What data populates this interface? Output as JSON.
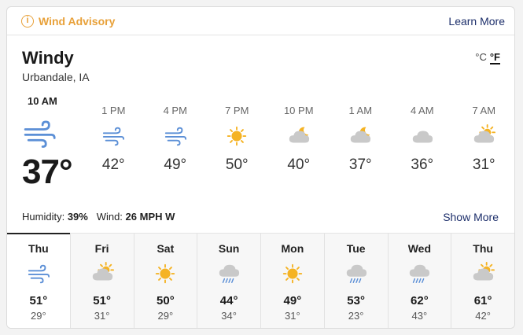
{
  "advisory": {
    "icon": "info-icon",
    "title": "Wind Advisory",
    "link": "Learn More"
  },
  "current": {
    "condition": "Windy",
    "location": "Urbandale, IA",
    "time": "10 AM",
    "icon": "wind-icon",
    "temp": "37°",
    "humidity_label": "Humidity:",
    "humidity": "39%",
    "wind_label": "Wind:",
    "wind": "26 MPH W"
  },
  "units": {
    "c": "°C",
    "f": "°F",
    "selected": "F"
  },
  "hourly": [
    {
      "time": "1 PM",
      "icon": "wind-icon",
      "temp": "42°"
    },
    {
      "time": "4 PM",
      "icon": "wind-icon",
      "temp": "49°"
    },
    {
      "time": "7 PM",
      "icon": "sun-icon",
      "temp": "50°"
    },
    {
      "time": "10 PM",
      "icon": "moon-cloud-icon",
      "temp": "40°"
    },
    {
      "time": "1 AM",
      "icon": "moon-cloud-icon",
      "temp": "37°"
    },
    {
      "time": "4 AM",
      "icon": "cloud-icon",
      "temp": "36°"
    },
    {
      "time": "7 AM",
      "icon": "sun-cloud-icon",
      "temp": "31°"
    }
  ],
  "show_more": "Show More",
  "daily": [
    {
      "day": "Thu",
      "icon": "wind-icon",
      "hi": "51°",
      "lo": "29°"
    },
    {
      "day": "Fri",
      "icon": "sun-cloud-icon",
      "hi": "51°",
      "lo": "31°"
    },
    {
      "day": "Sat",
      "icon": "sun-icon",
      "hi": "50°",
      "lo": "29°"
    },
    {
      "day": "Sun",
      "icon": "rain-cloud-icon",
      "hi": "44°",
      "lo": "34°"
    },
    {
      "day": "Mon",
      "icon": "sun-icon",
      "hi": "49°",
      "lo": "31°"
    },
    {
      "day": "Tue",
      "icon": "rain-cloud-icon",
      "hi": "53°",
      "lo": "23°"
    },
    {
      "day": "Wed",
      "icon": "rain-cloud-icon",
      "hi": "62°",
      "lo": "43°"
    },
    {
      "day": "Thu",
      "icon": "sun-cloud-icon",
      "hi": "61°",
      "lo": "42°"
    }
  ],
  "colors": {
    "accent": "#e8a13a",
    "link": "#1d2f6b",
    "wind": "#5b8fd6",
    "cloud": "#c9c9c9",
    "sun": "#f5b324"
  }
}
